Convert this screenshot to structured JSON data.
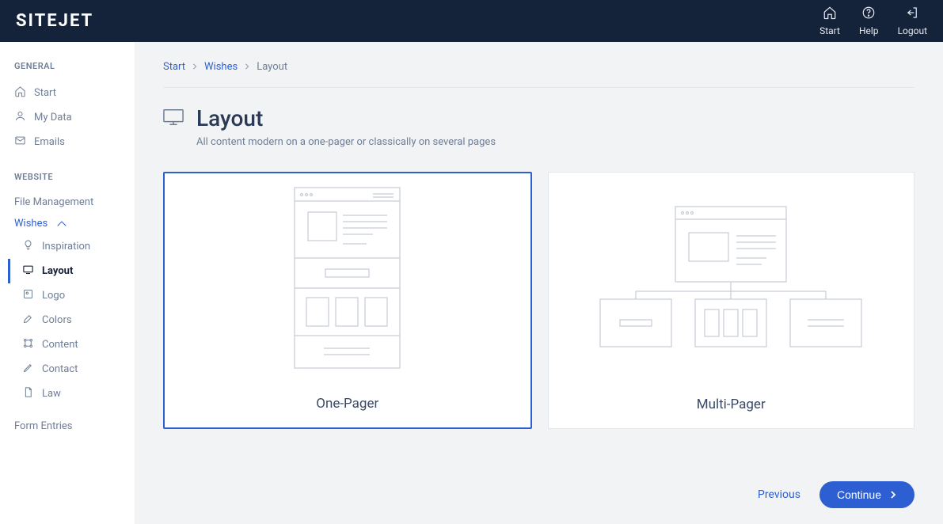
{
  "brand": "SITEJET",
  "header": {
    "start": "Start",
    "help": "Help",
    "logout": "Logout"
  },
  "sidebar": {
    "general_title": "GENERAL",
    "general_items": [
      {
        "label": "Start"
      },
      {
        "label": "My Data"
      },
      {
        "label": "Emails"
      }
    ],
    "website_title": "WEBSITE",
    "file_management": "File Management",
    "wishes": "Wishes",
    "wishes_items": [
      {
        "label": "Inspiration"
      },
      {
        "label": "Layout"
      },
      {
        "label": "Logo"
      },
      {
        "label": "Colors"
      },
      {
        "label": "Content"
      },
      {
        "label": "Contact"
      },
      {
        "label": "Law"
      }
    ],
    "form_entries": "Form Entries"
  },
  "breadcrumb": {
    "start": "Start",
    "wishes": "Wishes",
    "current": "Layout"
  },
  "page": {
    "title": "Layout",
    "subtitle": "All content modern on a one-pager or classically on several pages"
  },
  "options": {
    "one_pager": "One-Pager",
    "multi_pager": "Multi-Pager"
  },
  "footer": {
    "previous": "Previous",
    "continue": "Continue"
  }
}
